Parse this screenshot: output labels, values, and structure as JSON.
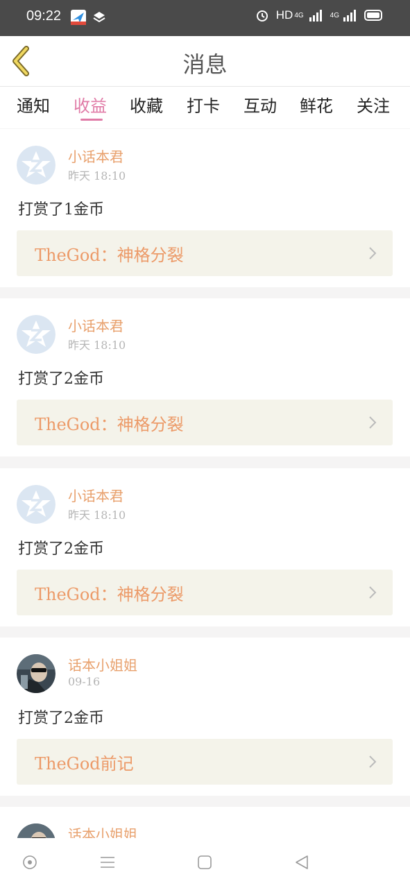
{
  "status_bar": {
    "time": "09:22",
    "hd_label": "HD",
    "net1": "4G",
    "net2": "4G"
  },
  "header": {
    "title": "消息"
  },
  "tabs": [
    {
      "label": "通知",
      "active": false
    },
    {
      "label": "收益",
      "active": true
    },
    {
      "label": "收藏",
      "active": false
    },
    {
      "label": "打卡",
      "active": false
    },
    {
      "label": "互动",
      "active": false
    },
    {
      "label": "鲜花",
      "active": false
    },
    {
      "label": "关注",
      "active": false
    }
  ],
  "messages": [
    {
      "user": "小话本君",
      "time": "昨天 18:10",
      "text": "打赏了1金币",
      "ref": "TheGod：神格分裂",
      "avatar": "logo-avatar"
    },
    {
      "user": "小话本君",
      "time": "昨天 18:10",
      "text": "打赏了2金币",
      "ref": "TheGod：神格分裂",
      "avatar": "logo-avatar"
    },
    {
      "user": "小话本君",
      "time": "昨天 18:10",
      "text": "打赏了2金币",
      "ref": "TheGod：神格分裂",
      "avatar": "logo-avatar"
    },
    {
      "user": "话本小姐姐",
      "time": "09-16",
      "text": "打赏了2金币",
      "ref": "TheGod前记",
      "avatar": "photo-avatar"
    },
    {
      "user": "话本小姐姐",
      "avatar": "photo-avatar"
    }
  ],
  "colors": {
    "accent": "#e07aa6",
    "username": "#e8a06c",
    "ref_text": "#ec9a68",
    "ref_bg": "#f4f3ea"
  }
}
